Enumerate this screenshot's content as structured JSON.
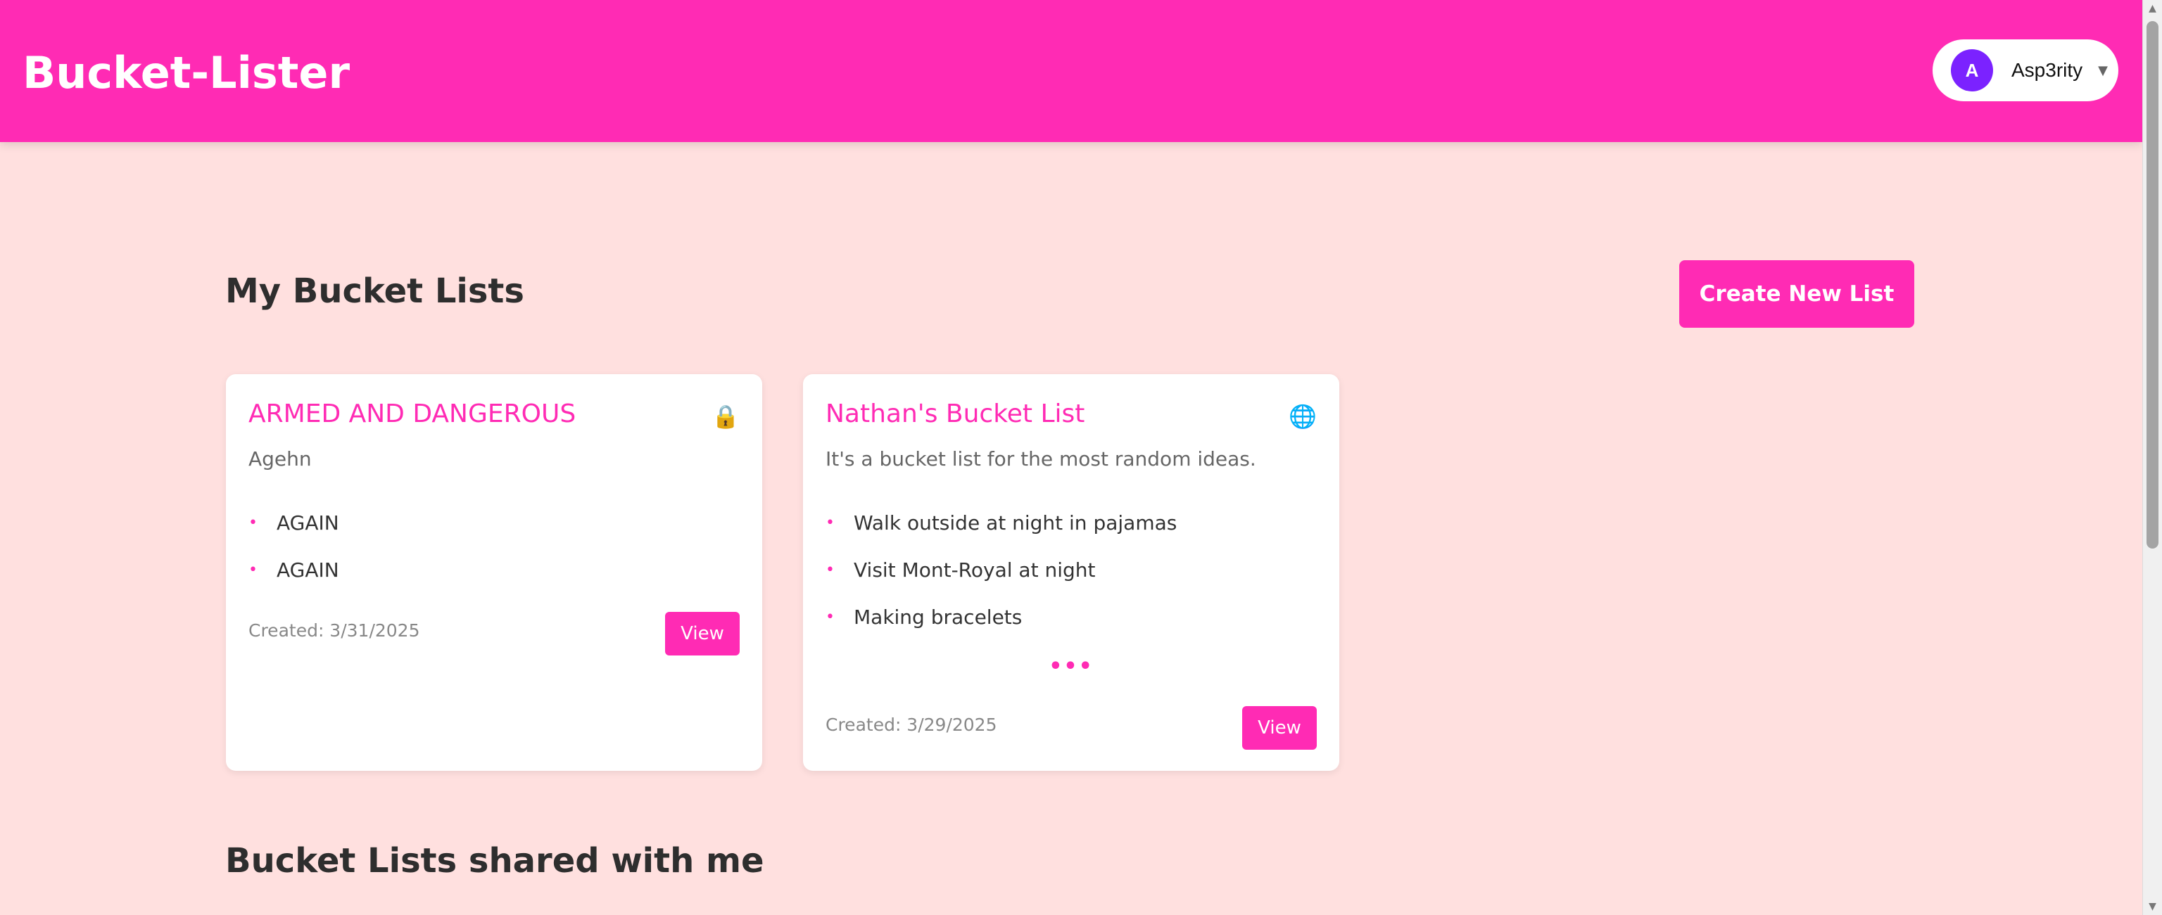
{
  "header": {
    "app_title": "Bucket-Lister",
    "user": {
      "avatar_initial": "A",
      "username": "Asp3rity",
      "caret": "▼"
    }
  },
  "main": {
    "my_lists_title": "My Bucket Lists",
    "create_button_label": "Create New List",
    "shared_title": "Bucket Lists shared with me",
    "cards": [
      {
        "title": "ARMED AND DANGEROUS",
        "visibility_icon": "lock-icon",
        "visibility_glyph": "🔒",
        "description": "Agehn",
        "items": [
          "AGAIN",
          "AGAIN"
        ],
        "more": "",
        "created": "Created: 3/31/2025",
        "view_label": "View"
      },
      {
        "title": "Nathan's Bucket List",
        "visibility_icon": "globe-icon",
        "visibility_glyph": "🌐",
        "description": "It's a bucket list for the most random ideas.",
        "items": [
          "Walk outside at night in pajamas",
          "Visit Mont-Royal at night",
          "Making bracelets"
        ],
        "more": "•••",
        "created": "Created: 3/29/2025",
        "view_label": "View"
      }
    ]
  },
  "colors": {
    "brand": "#ff2bb4",
    "background": "#ffe0df",
    "avatar": "#7b22ff"
  }
}
